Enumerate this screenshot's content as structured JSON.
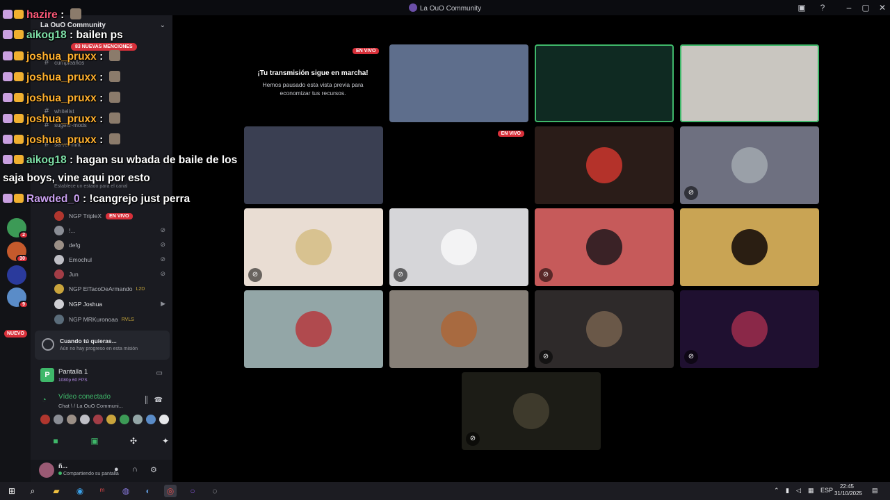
{
  "window": {
    "title": "La OuO Community"
  },
  "server": {
    "name": "La OuO Community",
    "mentions": "83 NUEVAS MENCIONES"
  },
  "channels": [
    {
      "name": "cumpleaños"
    },
    {
      "name": "whitelist"
    },
    {
      "name": "sugerir-mods"
    },
    {
      "name": "server-hint"
    }
  ],
  "status_hint": "Establece un estado para el canal",
  "rail_badges": {
    "b1": "2",
    "b2": "30",
    "b3": "9",
    "nuevo": "NUEVO"
  },
  "voice_users": [
    {
      "name": "NGP TripleX",
      "extra": "",
      "live": "EN VIVO",
      "color": "#b0362e"
    },
    {
      "name": "!...",
      "extra": "",
      "live": "",
      "color": "#8a8d95"
    },
    {
      "name": "defg",
      "extra": "",
      "live": "",
      "color": "#9b8f86"
    },
    {
      "name": "Emochul",
      "extra": "",
      "live": "",
      "color": "#bfbfc6"
    },
    {
      "name": "Jun",
      "extra": "",
      "live": "",
      "color": "#a23d46"
    },
    {
      "name": "NGP ElTacoDeArmando",
      "extra": "L2D",
      "live": "",
      "color": "#c9a43c"
    },
    {
      "name": "NGP Joshua",
      "extra": "",
      "live": "",
      "color": "#cfcfd4"
    },
    {
      "name": "NGP MRKuronoaa",
      "extra": "RVLS",
      "live": "",
      "color": "#5a6c7a"
    }
  ],
  "quest": {
    "title": "Cuando tú quieras...",
    "subtitle": "Aún no hay progreso en esta misión"
  },
  "screen_share": {
    "title": "Pantalla 1",
    "quality": "1080p 60 FPS",
    "thumb": "P"
  },
  "voice": {
    "title": "Vídeo conectado",
    "subtitle": "Chat \\ / La OuO Communi..."
  },
  "user": {
    "name": "ñ...",
    "status": "Compartiendo su pantalla"
  },
  "stage": {
    "live_label": "EN VIVO",
    "paused_title": "¡Tu transmisión sigue en marcha!",
    "paused_subtitle": "Hemos pausado esta vista previa para economizar tus recursos."
  },
  "tiles": [
    {
      "bg": "#5e6e8c",
      "face": "",
      "muted": false,
      "speaking": false,
      "live": ""
    },
    {
      "bg": "#0f2a22",
      "face": "",
      "muted": false,
      "speaking": true,
      "live": ""
    },
    {
      "bg": "#c9c6c0",
      "face": "",
      "muted": false,
      "speaking": true,
      "live": ""
    },
    {
      "bg": "#3a3f52",
      "face": "",
      "muted": false,
      "speaking": false,
      "live": ""
    },
    {
      "bg": "#000000",
      "face": "",
      "muted": false,
      "speaking": false,
      "live": "EN VIVO"
    },
    {
      "bg": "#2a1c18",
      "face": "#b4322a",
      "muted": false,
      "speaking": false,
      "live": ""
    },
    {
      "bg": "#6e7080",
      "face": "#9aa0a8",
      "muted": true,
      "speaking": false,
      "live": ""
    },
    {
      "bg": "#e9ddd3",
      "face": "#d8c290",
      "muted": true,
      "speaking": false,
      "live": ""
    },
    {
      "bg": "#d6d6d9",
      "face": "#f3f3f4",
      "muted": true,
      "speaking": false,
      "live": ""
    },
    {
      "bg": "#c65a5a",
      "face": "#3a2226",
      "muted": true,
      "speaking": false,
      "live": ""
    },
    {
      "bg": "#c9a454",
      "face": "#2a1e12",
      "muted": false,
      "speaking": false,
      "live": ""
    },
    {
      "bg": "#93a6a7",
      "face": "#b04a4e",
      "muted": false,
      "speaking": false,
      "live": ""
    },
    {
      "bg": "#878078",
      "face": "#a86a40",
      "muted": false,
      "speaking": false,
      "live": ""
    },
    {
      "bg": "#2e2a2a",
      "face": "#6a5848",
      "muted": true,
      "speaking": false,
      "live": ""
    },
    {
      "bg": "#1f1030",
      "face": "#8a2848",
      "muted": true,
      "speaking": false,
      "live": ""
    },
    {
      "bg": "#1c1c16",
      "face": "#3e3a2c",
      "muted": true,
      "speaking": false,
      "live": ""
    }
  ],
  "chat": [
    {
      "user": "hazire",
      "text": "",
      "color": "#ff5a7a"
    },
    {
      "user": "aikog18",
      "text": "bailen ps",
      "color": "#7ee0a8"
    },
    {
      "user": "joshua_pruxx",
      "text": "",
      "color": "#ffb02e"
    },
    {
      "user": "joshua_pruxx",
      "text": "",
      "color": "#ffb02e"
    },
    {
      "user": "joshua_pruxx",
      "text": "",
      "color": "#ffb02e"
    },
    {
      "user": "joshua_pruxx",
      "text": "",
      "color": "#ffb02e"
    },
    {
      "user": "joshua_pruxx",
      "text": "",
      "color": "#ffb02e"
    },
    {
      "user": "aikog18",
      "text": "hagan su wbada de baile de los",
      "color": "#7ee0a8"
    },
    {
      "user": "",
      "text": "saja boys,     vine aqui por esto",
      "color": "#ffffff"
    },
    {
      "user": "Rawded_0",
      "text": "!cangrejo just        perra",
      "color": "#c9a0f0"
    }
  ],
  "taskbar": {
    "lang": "ESP",
    "time": "22:45",
    "date": "31/10/2025"
  }
}
